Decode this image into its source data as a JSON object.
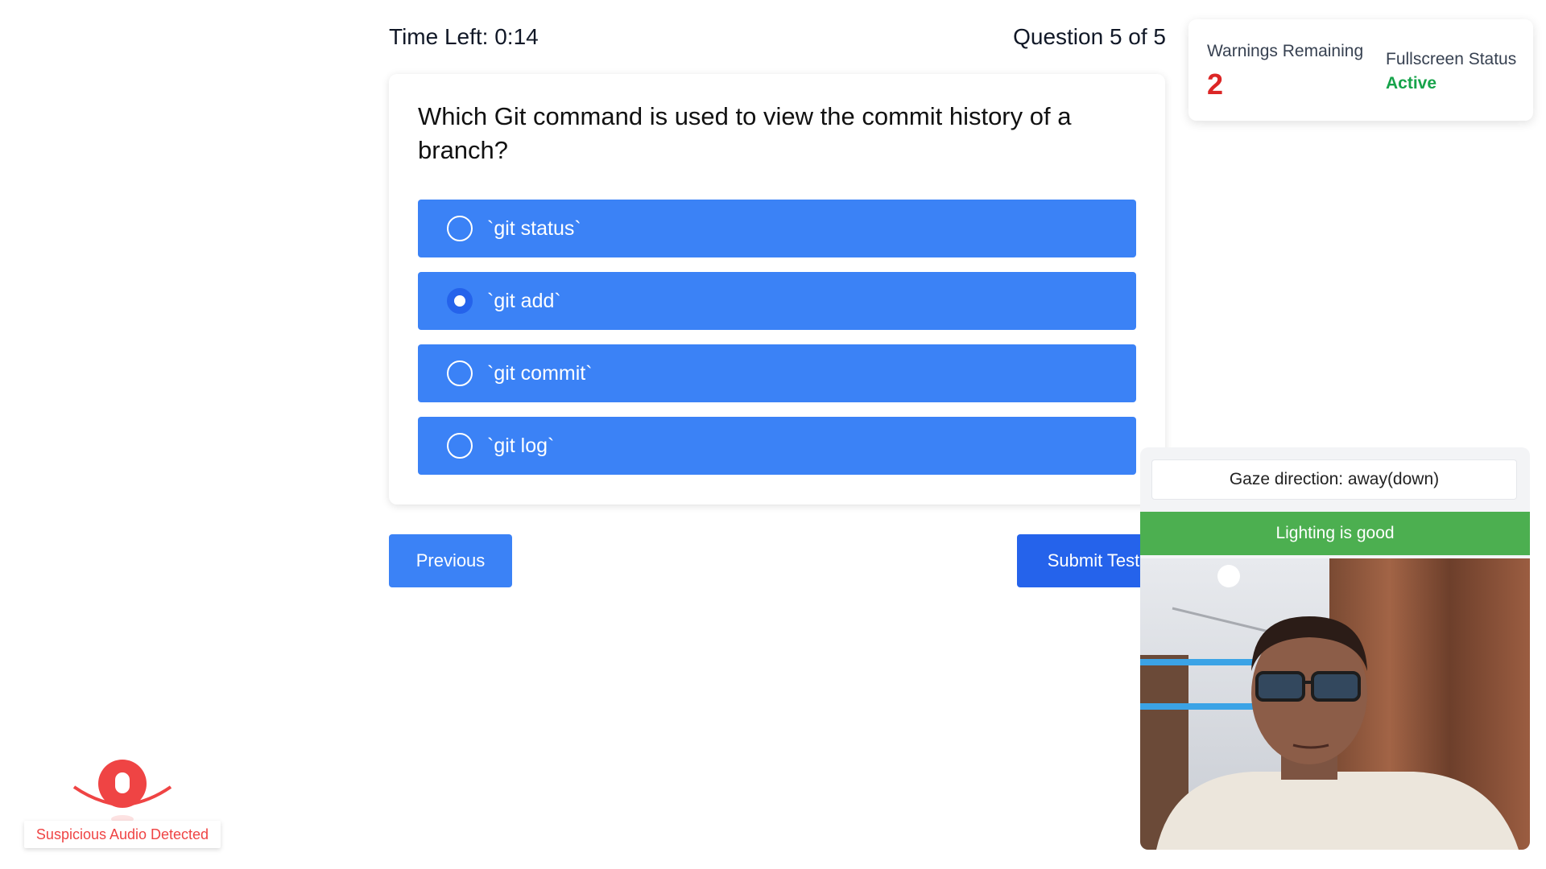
{
  "header": {
    "timer_text": "Time Left: 0:14",
    "question_counter": "Question 5 of 5"
  },
  "question": {
    "text": "Which Git command is used to view the commit history of a branch?",
    "options": [
      {
        "label": "`git status`",
        "selected": false
      },
      {
        "label": "`git add`",
        "selected": true
      },
      {
        "label": "`git commit`",
        "selected": false
      },
      {
        "label": "`git log`",
        "selected": false
      }
    ]
  },
  "buttons": {
    "previous_label": "Previous",
    "submit_label": "Submit Test"
  },
  "warnings": {
    "remaining_label": "Warnings Remaining",
    "remaining_count": "2",
    "fullscreen_label": "Fullscreen Status",
    "fullscreen_status": "Active"
  },
  "proctor": {
    "gaze_text": "Gaze direction: away(down)",
    "lighting_text": "Lighting is good"
  },
  "audio_alert": {
    "text": "Suspicious Audio Detected"
  },
  "colors": {
    "option_bg": "#3b82f6",
    "submit_bg": "#2563eb",
    "warning_count": "#dc2626",
    "status_active": "#16a34a",
    "lighting_ok": "#4caf50",
    "alert_red": "#ef4444"
  }
}
